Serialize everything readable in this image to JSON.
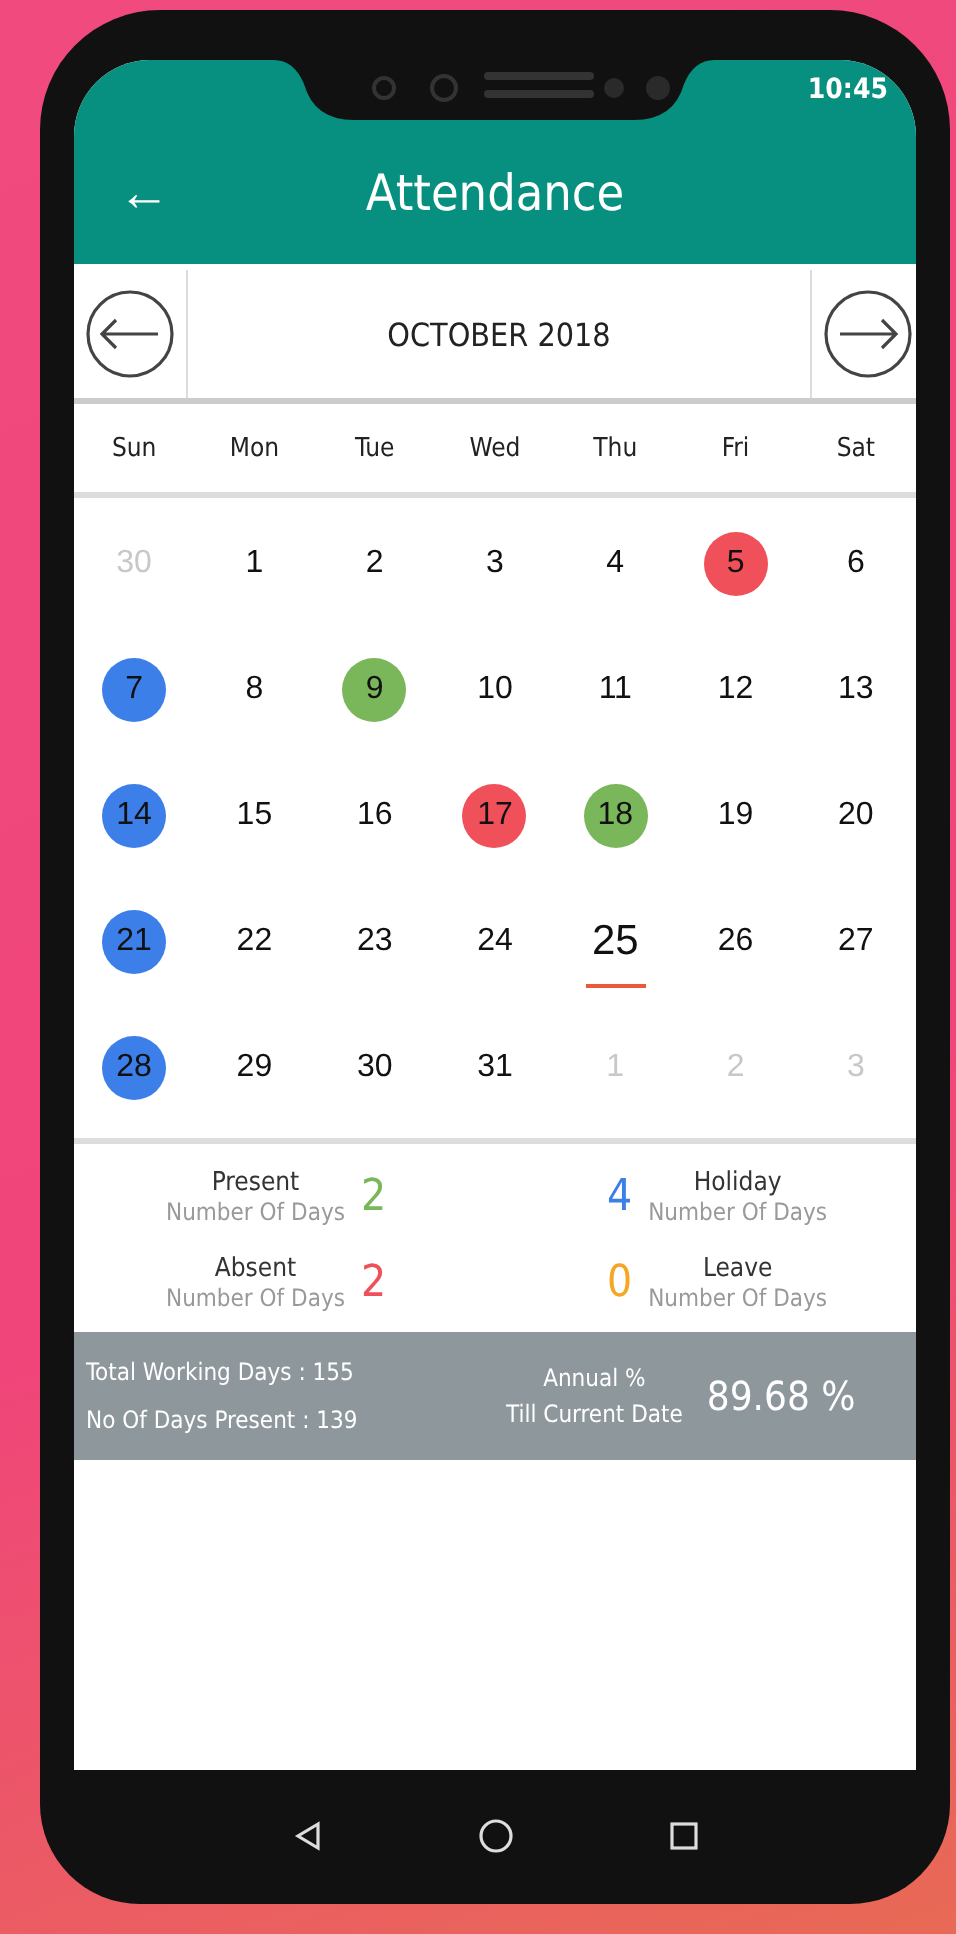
{
  "status_bar": {
    "time": "10:45"
  },
  "header": {
    "back": "←",
    "title": "Attendance"
  },
  "month": {
    "label": "OCTOBER 2018"
  },
  "weekdays": [
    "Sun",
    "Mon",
    "Tue",
    "Wed",
    "Thu",
    "Fri",
    "Sat"
  ],
  "days": [
    {
      "text": "30",
      "muted": true,
      "today": false
    },
    {
      "text": "1",
      "muted": false,
      "today": false
    },
    {
      "text": "2",
      "muted": false,
      "today": false
    },
    {
      "text": "3",
      "muted": false,
      "today": false
    },
    {
      "text": "4",
      "muted": false,
      "today": false
    },
    {
      "text": "5",
      "muted": false,
      "today": false,
      "color": "#f0505a"
    },
    {
      "text": "6",
      "muted": false,
      "today": false
    },
    {
      "text": "7",
      "muted": false,
      "today": false,
      "color": "#3d7fe8"
    },
    {
      "text": "8",
      "muted": false,
      "today": false
    },
    {
      "text": "9",
      "muted": false,
      "today": false,
      "color": "#7ab65a"
    },
    {
      "text": "10",
      "muted": false,
      "today": false
    },
    {
      "text": "11",
      "muted": false,
      "today": false
    },
    {
      "text": "12",
      "muted": false,
      "today": false
    },
    {
      "text": "13",
      "muted": false,
      "today": false
    },
    {
      "text": "14",
      "muted": false,
      "today": false,
      "color": "#3d7fe8"
    },
    {
      "text": "15",
      "muted": false,
      "today": false
    },
    {
      "text": "16",
      "muted": false,
      "today": false
    },
    {
      "text": "17",
      "muted": false,
      "today": false,
      "color": "#f0505a"
    },
    {
      "text": "18",
      "muted": false,
      "today": false,
      "color": "#7ab65a"
    },
    {
      "text": "19",
      "muted": false,
      "today": false
    },
    {
      "text": "20",
      "muted": false,
      "today": false
    },
    {
      "text": "21",
      "muted": false,
      "today": false,
      "color": "#3d7fe8"
    },
    {
      "text": "22",
      "muted": false,
      "today": false
    },
    {
      "text": "23",
      "muted": false,
      "today": false
    },
    {
      "text": "24",
      "muted": false,
      "today": false
    },
    {
      "text": "25",
      "muted": false,
      "today": true
    },
    {
      "text": "26",
      "muted": false,
      "today": false
    },
    {
      "text": "27",
      "muted": false,
      "today": false
    },
    {
      "text": "28",
      "muted": false,
      "today": false,
      "color": "#3d7fe8"
    },
    {
      "text": "29",
      "muted": false,
      "today": false
    },
    {
      "text": "30",
      "muted": false,
      "today": false
    },
    {
      "text": "31",
      "muted": false,
      "today": false
    },
    {
      "text": "1",
      "muted": true,
      "today": false
    },
    {
      "text": "2",
      "muted": true,
      "today": false
    },
    {
      "text": "3",
      "muted": true,
      "today": false
    }
  ],
  "summary": [
    {
      "label": "Present",
      "sub": "Number Of Days",
      "count": "2",
      "color": "#7ab65a"
    },
    {
      "label": "Holiday",
      "sub": "Number Of Days",
      "count": "4",
      "color": "#3d7fe8"
    },
    {
      "label": "Absent",
      "sub": "Number Of Days",
      "count": "2",
      "color": "#f0505a"
    },
    {
      "label": "Leave",
      "sub": "Number Of Days",
      "count": "0",
      "color": "#f5a623"
    }
  ],
  "totals": {
    "lines": [
      "Total Working Days :  155",
      "No Of Days Present :  139"
    ],
    "annual_label": "Annual %",
    "annual_sub": "Till Current Date",
    "annual_value": "89.68 %"
  }
}
